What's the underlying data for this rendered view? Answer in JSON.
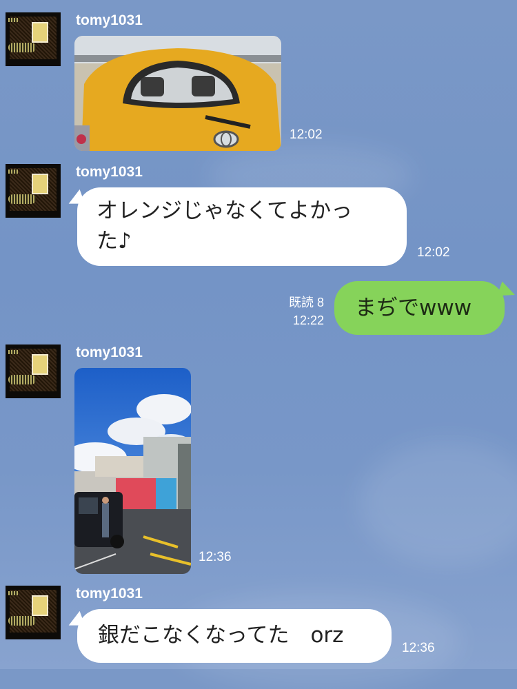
{
  "messages": [
    {
      "sender": "tomy1031",
      "type": "image",
      "alt": "yellow car rear window with Toyota emblem",
      "time": "12:02"
    },
    {
      "sender": "tomy1031",
      "type": "text",
      "text_line1": "オレンジじゃなくてよかっ",
      "text_line2": "た♪",
      "time": "12:02"
    },
    {
      "sender": "me",
      "type": "text",
      "text": "まぢでwww",
      "read_label": "既読 8",
      "time": "12:22"
    },
    {
      "sender": "tomy1031",
      "type": "image",
      "alt": "roadside store parking lot under blue sky with clouds",
      "time": "12:36"
    },
    {
      "sender": "tomy1031",
      "type": "text",
      "text": "銀だこなくなってた　orz",
      "time": "12:36"
    }
  ],
  "colors": {
    "background": "#7a98c7",
    "incoming_bubble": "#ffffff",
    "outgoing_bubble": "#86d35a"
  }
}
